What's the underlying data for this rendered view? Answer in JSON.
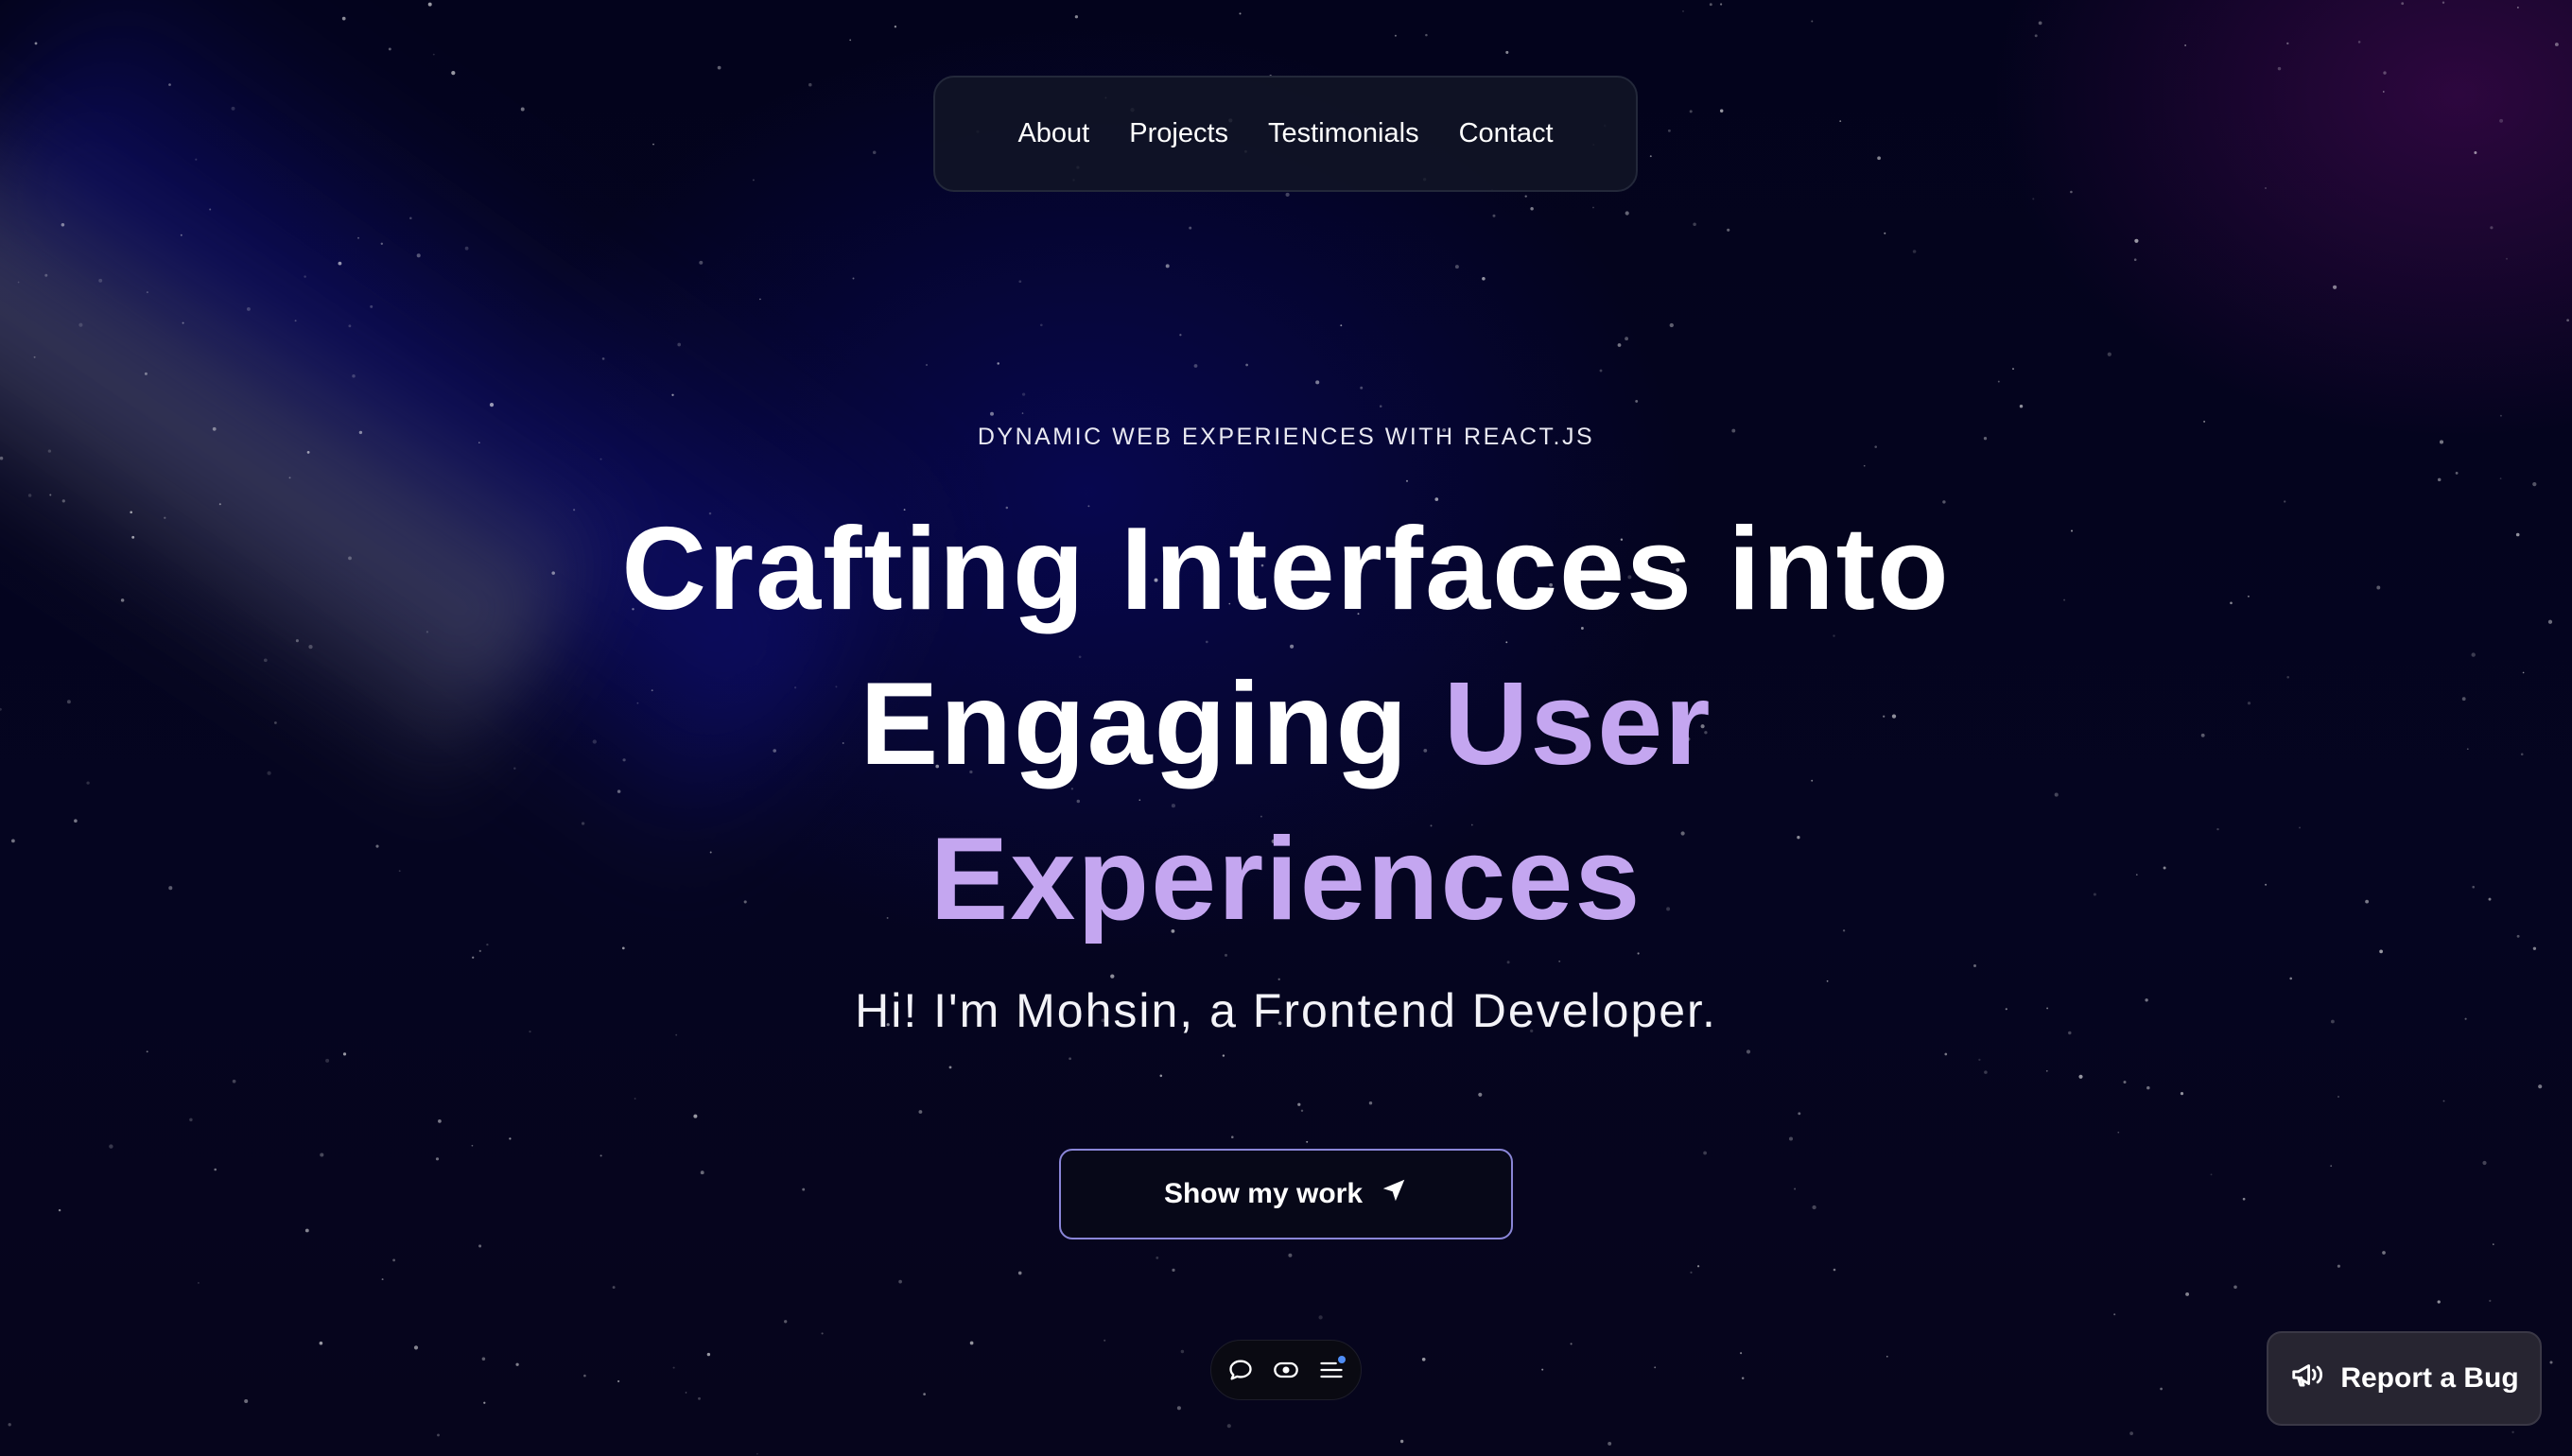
{
  "nav": {
    "items": [
      {
        "label": "About"
      },
      {
        "label": "Projects"
      },
      {
        "label": "Testimonials"
      },
      {
        "label": "Contact"
      }
    ]
  },
  "hero": {
    "eyebrow": "DYNAMIC WEB EXPERIENCES WITH REACT.JS",
    "headline_part1": "Crafting Interfaces into",
    "headline_part2": "Engaging",
    "headline_accent": "User Experiences",
    "subtitle": "Hi! I'm Mohsin, a Frontend Developer.",
    "cta_label": "Show my work"
  },
  "dock": {
    "icons": [
      "chat-icon",
      "toggle-icon",
      "menu-icon"
    ]
  },
  "report_bug": {
    "label": "Report a Bug",
    "icon": "megaphone-icon"
  },
  "colors": {
    "background": "#03031a",
    "accent": "#c4a6f0",
    "nav_bg": "#111526",
    "cta_border": "#8a86d8",
    "bug_bg": "#272531",
    "notification_dot": "#4f8df5"
  }
}
